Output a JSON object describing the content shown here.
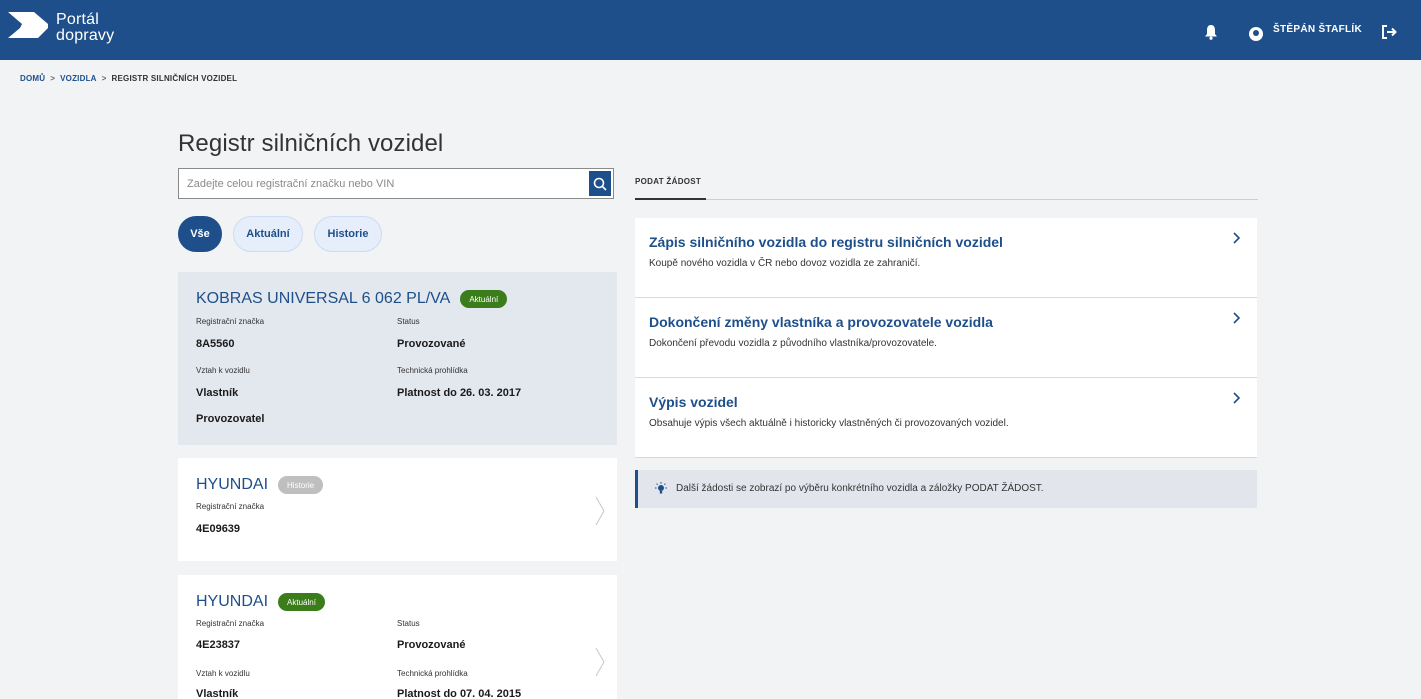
{
  "header": {
    "logo_line1": "Portál",
    "logo_line2": "dopravy",
    "username": "ŠTĚPÁN ŠTAFLÍK",
    "colors": {
      "brand": "#1e4f8a"
    }
  },
  "breadcrumb": {
    "items": [
      "DOMŮ",
      "VOZIDLA",
      "REGISTR SILNIČNÍCH VOZIDEL"
    ],
    "separator": ">"
  },
  "page_title": "Registr silničních vozidel",
  "search": {
    "placeholder": "Zadejte celou registrační značku nebo VIN",
    "value": ""
  },
  "filters": [
    {
      "label": "Vše",
      "active": true
    },
    {
      "label": "Aktuální",
      "active": false
    },
    {
      "label": "Historie",
      "active": false
    }
  ],
  "vehicles": [
    {
      "title": "KOBRAS UNIVERSAL 6 062 PL/VA",
      "badge": "Aktuální",
      "reg_label": "Registrační značka",
      "reg_value": "8A5560",
      "status_label": "Status",
      "status_value": "Provozované",
      "relation_label": "Vztah k vozidlu",
      "relation_values": [
        "Vlastník",
        "Provozovatel"
      ],
      "inspection_label": "Technická prohlídka",
      "inspection_value": "Platnost do 26. 03. 2017"
    },
    {
      "title": "HYUNDAI",
      "badge": "Historie",
      "reg_label": "Registrační značka",
      "reg_value": "4E09639"
    },
    {
      "title": "HYUNDAI",
      "badge": "Aktuální",
      "reg_label": "Registrační značka",
      "reg_value": "4E23837",
      "status_label": "Status",
      "status_value": "Provozované",
      "relation_label": "Vztah k vozidlu",
      "relation_values": [
        "Vlastník"
      ],
      "inspection_label": "Technická prohlídka",
      "inspection_value": "Platnost do 07. 04. 2015"
    }
  ],
  "right_panel": {
    "tab_label": "PODAT ŽÁDOST",
    "actions": [
      {
        "title": "Zápis silničního vozidla do registru silničních vozidel",
        "desc": "Koupě nového vozidla v ČR nebo dovoz vozidla ze zahraničí."
      },
      {
        "title": "Dokončení změny vlastníka a provozovatele vozidla",
        "desc": "Dokončení převodu vozidla z původního vlastníka/provozovatele."
      },
      {
        "title": "Výpis vozidel",
        "desc": "Obsahuje výpis všech aktuálně i historicky vlastněných či provozovaných vozidel."
      }
    ],
    "info": "Další žádosti se zobrazí po výběru konkrétního vozidla a záložky PODAT ŽÁDOST."
  },
  "icons": [
    "logo-icon",
    "bell-icon",
    "user-icon",
    "logout-icon",
    "search-icon",
    "chevron-right-icon",
    "lightbulb-icon"
  ]
}
